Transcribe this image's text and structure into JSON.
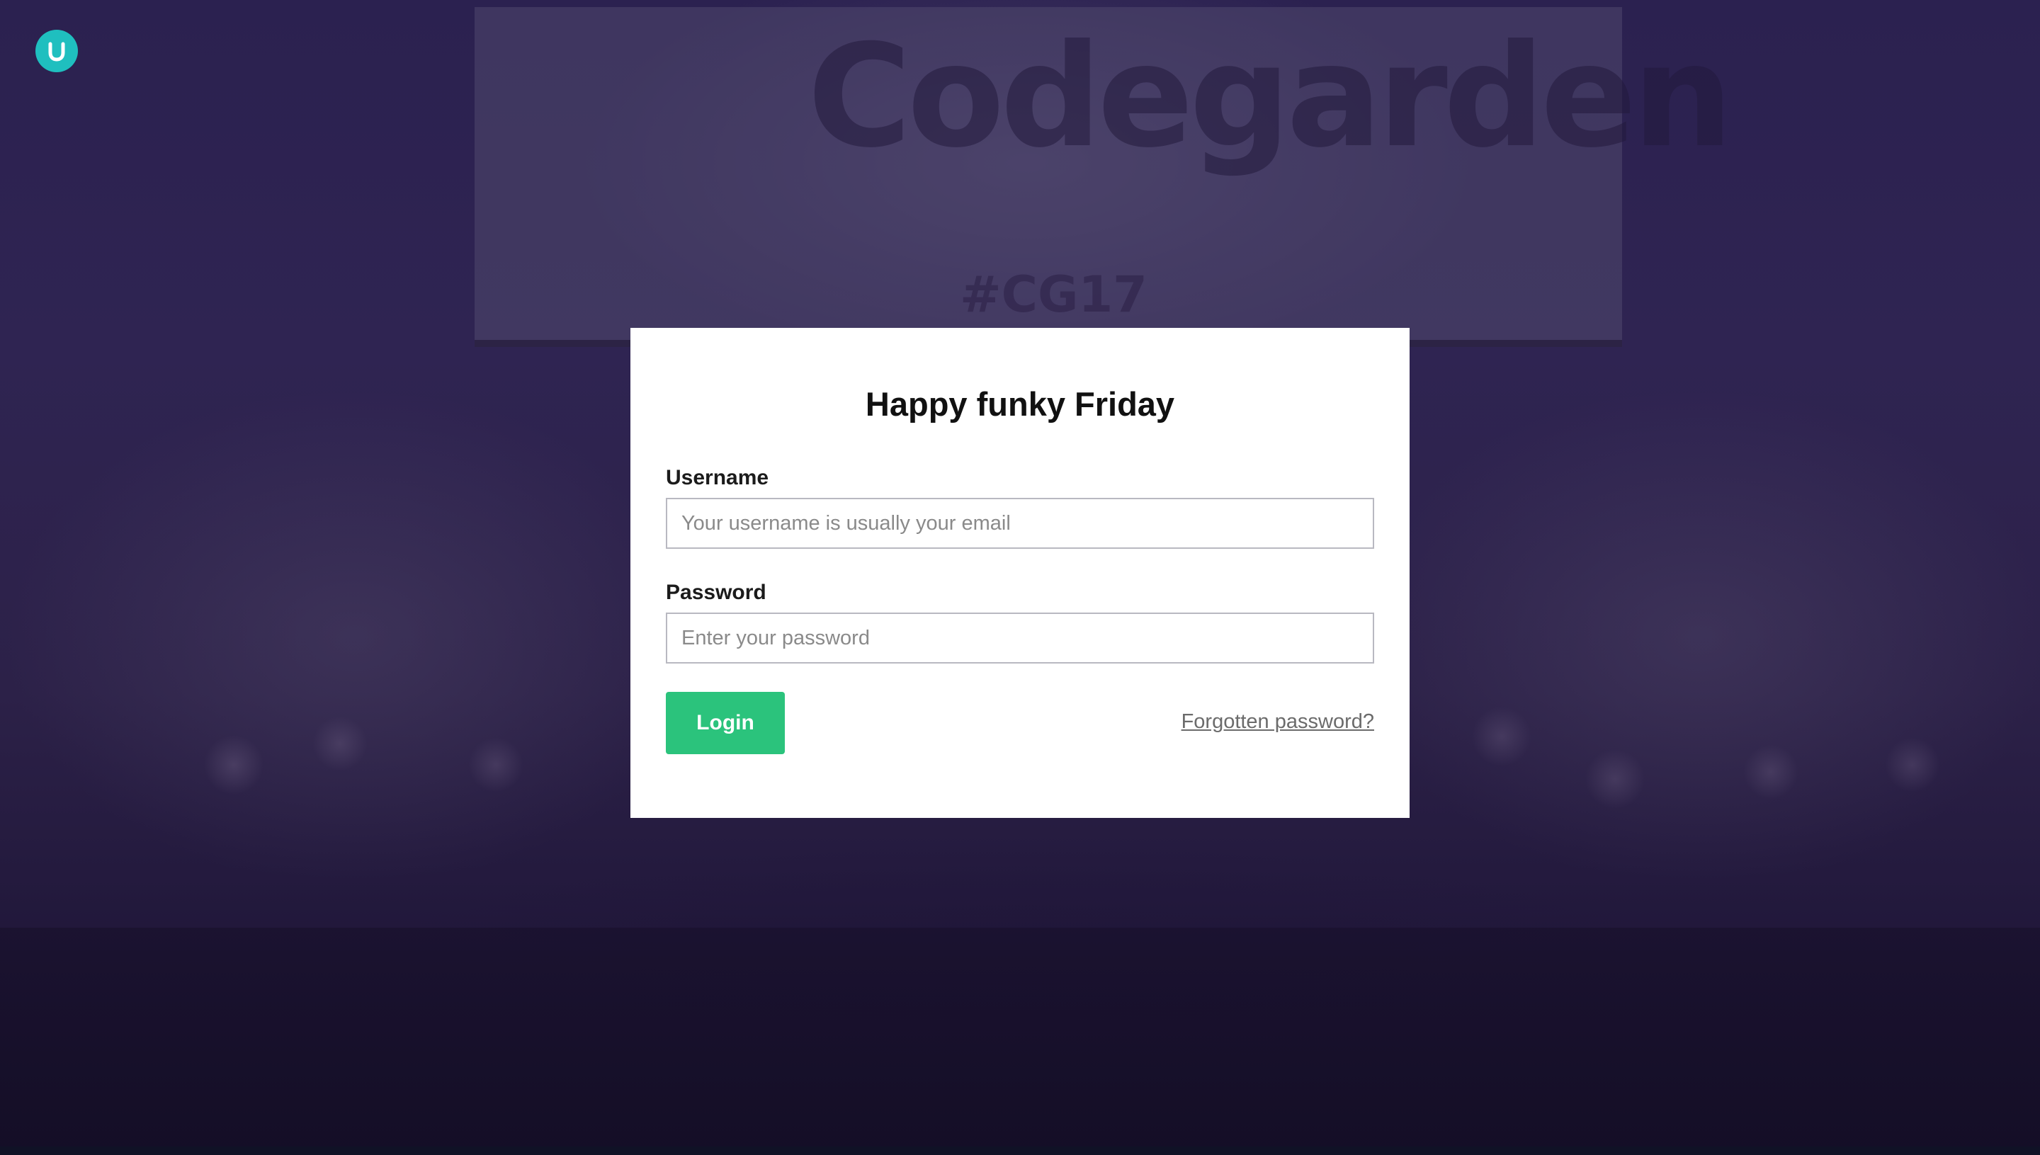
{
  "background": {
    "banner_text": "Codegarden",
    "banner_tag": "#CG17"
  },
  "logo": {
    "icon": "umbraco-logo-icon",
    "color": "#1fbfbf"
  },
  "login": {
    "greeting": "Happy funky Friday",
    "username_label": "Username",
    "username_placeholder": "Your username is usually your email",
    "username_value": "",
    "password_label": "Password",
    "password_placeholder": "Enter your password",
    "password_value": "",
    "login_button": "Login",
    "forgot_link": "Forgotten password?",
    "button_color": "#2bc37c"
  }
}
